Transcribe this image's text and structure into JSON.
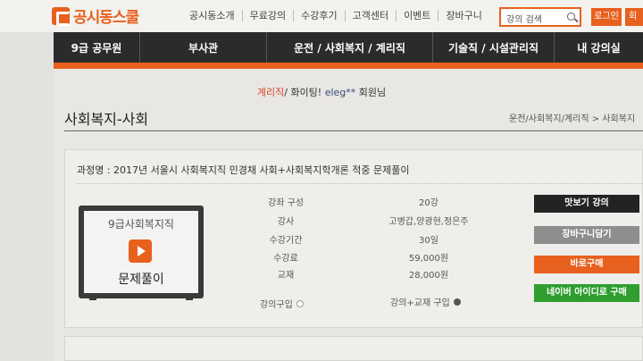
{
  "header": {
    "logo": "공시동스쿨",
    "nav": [
      "공시동소개",
      "무료강의",
      "수강후기",
      "고객센터",
      "이벤트",
      "장바구니"
    ],
    "search_placeholder": "강의 검색",
    "login_label": "로그인",
    "join_label": "회"
  },
  "main_nav": [
    "9급 공무원",
    "부사관",
    "운전 / 사회복지 / 계리직",
    "기술직 / 시설관리직",
    "내 강의실"
  ],
  "welcome": {
    "category": "계리직",
    "message": "/ 화이팅!",
    "user": "eleg**",
    "suffix": "회원님"
  },
  "page_title": "사회복지-사회",
  "breadcrumb": "운전/사회복지/계리직 > 사회복지",
  "course": {
    "name": "과정명 : 2017년 서울시 사회복지직 민경채 사회+사회복지학개론 적중 문제풀이",
    "thumbnail_top": "9급사회복지직",
    "thumbnail_bottom": "문제풀이",
    "info": [
      {
        "label": "강좌 구성",
        "value": "20강"
      },
      {
        "label": "강사",
        "value": "고병갑,양광현,정은주"
      },
      {
        "label": "수강기간",
        "value": "30일"
      },
      {
        "label": "수강료",
        "value": "59,000원"
      },
      {
        "label": "교재",
        "value": "28,000원"
      }
    ],
    "options": {
      "lecture_only": "강의구입",
      "lecture_book": "강의+교재 구입"
    }
  },
  "buttons": {
    "preview": "맛보기 강의",
    "cart": "장바구니담기",
    "buy_now": "바로구매",
    "naver_buy": "네이버 아이디로 구매"
  },
  "colors": {
    "accent": "#e8601e",
    "nav_bg": "#2b2b2b",
    "naver": "#2f9e2f"
  }
}
